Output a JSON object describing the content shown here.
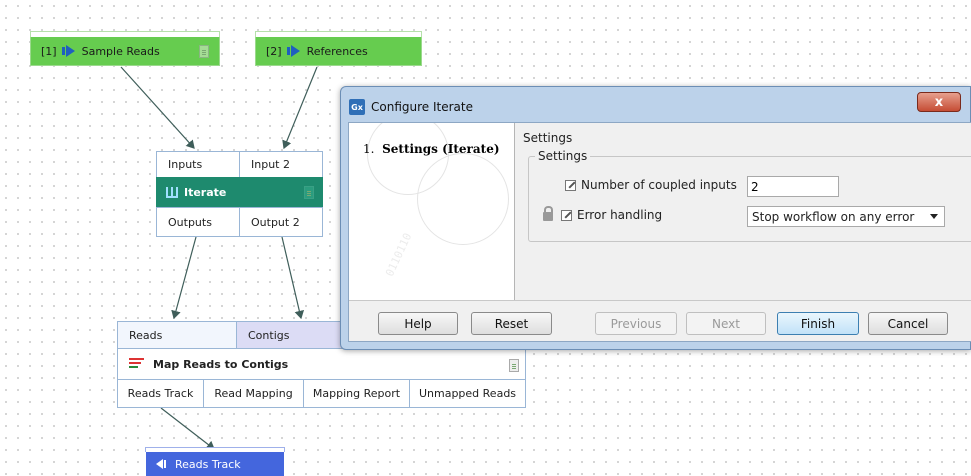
{
  "workflow": {
    "sample_reads": {
      "index": "[1]",
      "label": "Sample Reads"
    },
    "references": {
      "index": "[2]",
      "label": "References"
    },
    "iterate": {
      "input1": "Inputs",
      "input2": "Input 2",
      "title": "Iterate",
      "output1": "Outputs",
      "output2": "Output 2"
    },
    "map_reads": {
      "in_reads": "Reads",
      "in_contigs": "Contigs",
      "title": "Map Reads to Contigs",
      "outputs": [
        "Reads Track",
        "Read Mapping",
        "Mapping Report",
        "Unmapped Reads"
      ]
    },
    "reads_track_output": {
      "label": "Reads Track"
    }
  },
  "dialog": {
    "app_icon": "Gx",
    "title": "Configure Iterate",
    "close_label": "x",
    "steps": [
      {
        "number": "1.",
        "label": "Settings (Iterate)"
      }
    ],
    "watermark_digits": "0110110",
    "pane_title": "Settings",
    "group_title": "Settings",
    "fields": {
      "coupled_inputs": {
        "label": "Number of coupled inputs",
        "value": "2"
      },
      "error_handling": {
        "label": "Error handling",
        "selected": "Stop workflow on any error"
      }
    },
    "buttons": {
      "help": "Help",
      "reset": "Reset",
      "previous": "Previous",
      "next": "Next",
      "finish": "Finish",
      "cancel": "Cancel"
    }
  },
  "colors": {
    "input_node": "#66cc4f",
    "iterate_bar": "#1e8a6e",
    "reads_track_node": "#4466dd",
    "dialog_frame": "#bcd2ea",
    "close_button": "#c54d35"
  }
}
